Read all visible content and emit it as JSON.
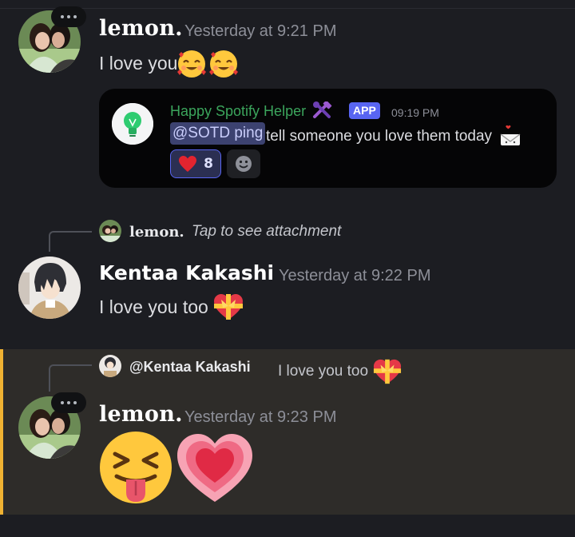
{
  "messages": [
    {
      "author": "lemon.",
      "timestamp": "Yesterday at 9:21 PM",
      "text": "I love you",
      "emojis": [
        "smiling-face-with-hearts-emoji",
        "smiling-face-with-hearts-emoji"
      ]
    },
    {
      "author": "Kentaa Kakashi",
      "timestamp": "Yesterday at 9:22 PM",
      "text": "I love you too",
      "emojis": [
        "heart-with-ribbon-emoji"
      ],
      "reply": {
        "author": "lemon.",
        "text": "Tap to see attachment"
      }
    },
    {
      "author": "lemon.",
      "timestamp": "Yesterday at 9:23 PM",
      "text": "",
      "emojis": [
        "squinting-face-with-tongue-emoji",
        "growing-heart-emoji"
      ],
      "highlighted": true,
      "reply": {
        "author": "@Kentaa Kakashi",
        "text": "I love you too"
      }
    }
  ],
  "embed": {
    "bot_name": "Happy Spotify Helper",
    "bot_icon": "hammer-and-wrench-icon",
    "badge": "APP",
    "timestamp": "09:19 PM",
    "mention": "@SOTD ping",
    "text": "tell someone you love them today",
    "reaction": {
      "emoji": "heart-icon",
      "count": "8"
    },
    "add_reaction_icon": "smiley-icon"
  },
  "colors": {
    "background": "#1c1d22",
    "highlight": "#2e2c29",
    "highlight_bar": "#f0b232",
    "bot_name": "#3ba55c",
    "badge": "#5865f2",
    "mention_bg": "#3c4270"
  }
}
